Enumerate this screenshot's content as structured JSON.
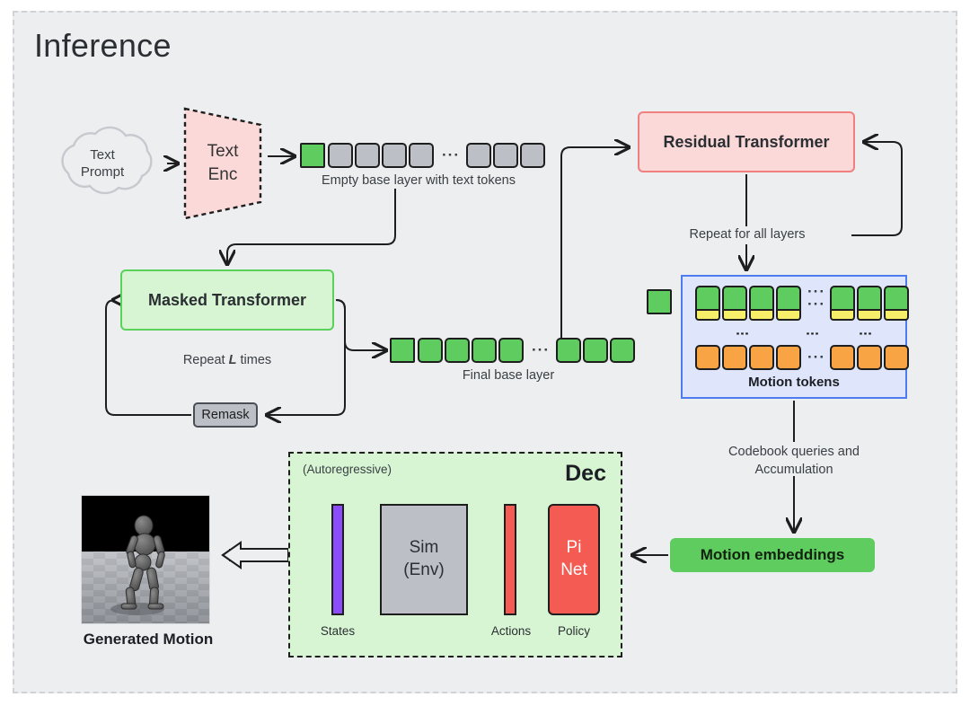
{
  "figure": {
    "title": "Inference",
    "background": "#eceef0",
    "border_color": "#cfd3d8"
  },
  "colors": {
    "green": "#5ecc5e",
    "gray_token": "#bcc0c6",
    "orange": "#f9a444",
    "yellow": "#f7ef6a",
    "red_box": "#fbd9d9",
    "red_border": "#f08080",
    "green_box": "#d7f5d3",
    "green_border": "#5ad15a",
    "blue_panel": "#dfe6fb",
    "blue_border": "#4d7cf0",
    "purple": "#8b4dfa",
    "red_solid": "#f45b52",
    "stroke": "#1e1e1e"
  },
  "text_prompt": {
    "line1": "Text",
    "line2": "Prompt"
  },
  "text_encoder": {
    "line1": "Text",
    "line2": "Enc"
  },
  "base_layer": {
    "caption": "Empty base layer with text tokens",
    "left_tokens": [
      "green",
      "gray",
      "gray",
      "gray",
      "gray"
    ],
    "ellipsis": "···",
    "right_tokens": [
      "gray",
      "gray",
      "gray"
    ]
  },
  "masked_transformer": {
    "label": "Masked Transformer"
  },
  "repeat_note": {
    "prefix": "Repeat ",
    "emphasis": "L",
    "suffix": " times"
  },
  "remask": {
    "label": "Remask"
  },
  "final_base_layer": {
    "caption": "Final base layer",
    "left_tokens": [
      "green",
      "green",
      "green",
      "green",
      "green"
    ],
    "ellipsis": "···",
    "right_tokens": [
      "green",
      "green",
      "green"
    ]
  },
  "residual_transformer": {
    "label": "Residual Transformer"
  },
  "repeat_layers_note": {
    "label": "Repeat for all layers"
  },
  "motion_tokens": {
    "caption": "Motion tokens",
    "standalone_token": "green",
    "top_row_left_count": 4,
    "top_row_right_count": 3,
    "bottom_row_left_count": 4,
    "bottom_row_right_count": 3,
    "horizontal_ellipsis": "···",
    "vertical_ellipsis": "⋮"
  },
  "codebook_note": {
    "line1": "Codebook queries and",
    "line2": "Accumulation"
  },
  "motion_embeddings": {
    "label": "Motion embeddings"
  },
  "decoder": {
    "autoregressive_note": "(Autoregressive)",
    "title": "Dec",
    "states_label": "States",
    "sim_line1": "Sim",
    "sim_line2": "(Env)",
    "actions_label": "Actions",
    "policy_label": "Policy",
    "pinet_line1": "Pi",
    "pinet_line2": "Net"
  },
  "generated_motion": {
    "caption": "Generated Motion"
  }
}
